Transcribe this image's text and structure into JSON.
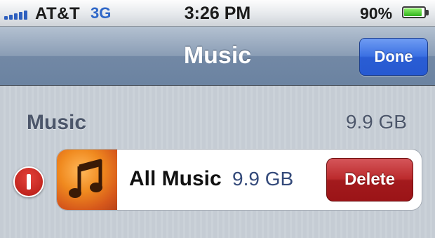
{
  "status_bar": {
    "carrier": "AT&T",
    "network": "3G",
    "time": "3:26 PM",
    "battery_percent": "90%",
    "battery_level": 0.9,
    "signal_bars": 5
  },
  "nav_bar": {
    "title": "Music",
    "done_label": "Done"
  },
  "section": {
    "title": "Music",
    "size": "9.9 GB"
  },
  "row": {
    "title": "All Music",
    "size": "9.9 GB",
    "delete_label": "Delete",
    "icon": "music-note-icon"
  },
  "colors": {
    "done_button": "#2a5dd4",
    "delete_button": "#b01f22",
    "delete_control": "#c7241d",
    "battery": "#4cc32a",
    "network": "#2f67c8"
  }
}
